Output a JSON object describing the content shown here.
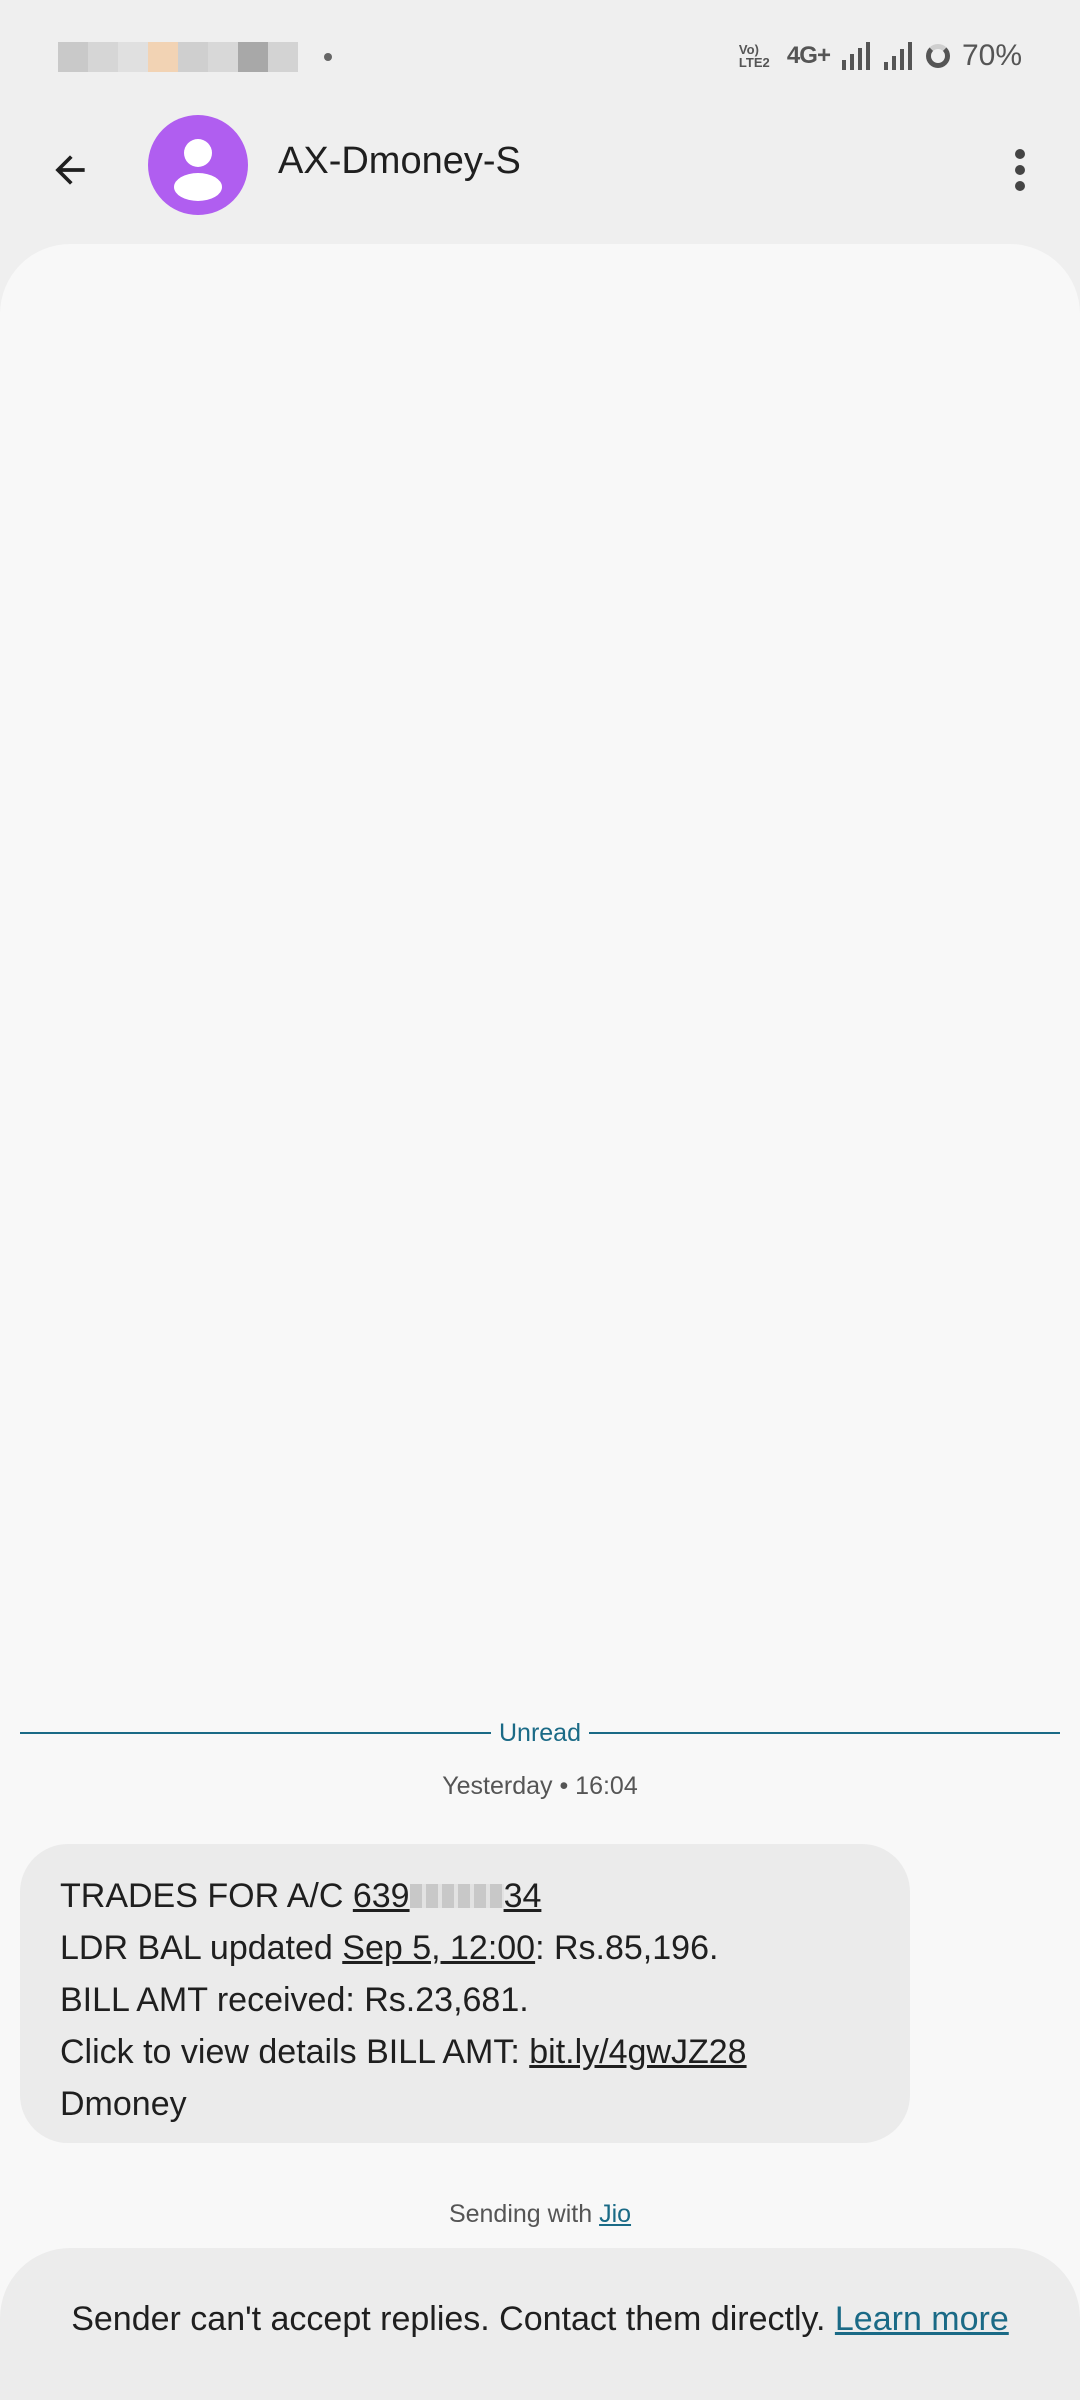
{
  "status_bar": {
    "battery": "70%",
    "network": "4G+",
    "volte": "Vo)) LTE2"
  },
  "header": {
    "contact_name": "AX-Dmoney-S",
    "avatar_color": "#b05ef0",
    "back_icon": "arrow-left-icon",
    "more_icon": "more-vert-icon"
  },
  "conversation": {
    "divider_label": "Unread",
    "timestamp": "Yesterday • 16:04",
    "message": {
      "line1_prefix": "TRADES FOR A/C ",
      "account_start": "639",
      "account_end": "34",
      "line2_prefix": "LDR BAL updated ",
      "date_link": "Sep 5, 12:00",
      "line2_suffix": ": Rs.85,196.",
      "line3": "BILL AMT received: Rs.23,681.",
      "line4_prefix": "Click to view details BILL AMT: ",
      "url_link": "bit.ly/4gwJZ28",
      "line5": "Dmoney"
    },
    "sending_prefix": "Sending with ",
    "carrier": "Jio"
  },
  "reply_banner": {
    "text": "Sender can't accept replies. Contact them directly. ",
    "link": "Learn more"
  },
  "colors": {
    "accent": "#1a6a86",
    "bubble": "#ebebeb",
    "background": "#f8f8f8"
  }
}
